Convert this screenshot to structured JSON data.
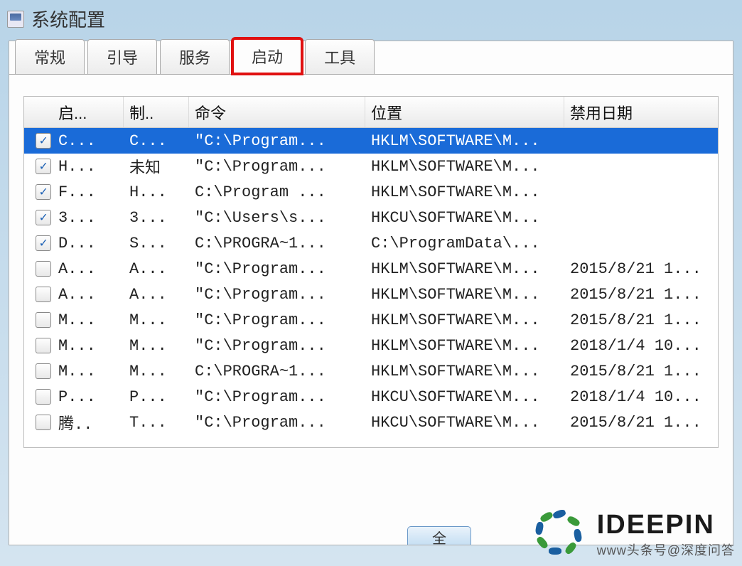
{
  "window": {
    "title": "系统配置"
  },
  "tabs": [
    {
      "label": "常规"
    },
    {
      "label": "引导"
    },
    {
      "label": "服务"
    },
    {
      "label": "启动"
    },
    {
      "label": "工具"
    }
  ],
  "columns": {
    "startup": "启...",
    "maker": "制..",
    "command": "命令",
    "location": "位置",
    "disabled_date": "禁用日期"
  },
  "rows": [
    {
      "checked": true,
      "selected": true,
      "startup": "C...",
      "maker": "C...",
      "cmd": "\"C:\\Program...",
      "loc": "HKLM\\SOFTWARE\\M...",
      "date": ""
    },
    {
      "checked": true,
      "selected": false,
      "startup": "H...",
      "maker": "未知",
      "cmd": "\"C:\\Program...",
      "loc": "HKLM\\SOFTWARE\\M...",
      "date": ""
    },
    {
      "checked": true,
      "selected": false,
      "startup": "F...",
      "maker": "H...",
      "cmd": "C:\\Program ...",
      "loc": "HKLM\\SOFTWARE\\M...",
      "date": ""
    },
    {
      "checked": true,
      "selected": false,
      "startup": "3...",
      "maker": "3...",
      "cmd": "\"C:\\Users\\s...",
      "loc": "HKCU\\SOFTWARE\\M...",
      "date": ""
    },
    {
      "checked": true,
      "selected": false,
      "startup": "D...",
      "maker": "S...",
      "cmd": "C:\\PROGRA~1...",
      "loc": "C:\\ProgramData\\...",
      "date": ""
    },
    {
      "checked": false,
      "selected": false,
      "startup": "A...",
      "maker": "A...",
      "cmd": "\"C:\\Program...",
      "loc": "HKLM\\SOFTWARE\\M...",
      "date": "2015/8/21 1..."
    },
    {
      "checked": false,
      "selected": false,
      "startup": "A...",
      "maker": "A...",
      "cmd": "\"C:\\Program...",
      "loc": "HKLM\\SOFTWARE\\M...",
      "date": "2015/8/21 1..."
    },
    {
      "checked": false,
      "selected": false,
      "startup": "M...",
      "maker": "M...",
      "cmd": "\"C:\\Program...",
      "loc": "HKLM\\SOFTWARE\\M...",
      "date": "2015/8/21 1..."
    },
    {
      "checked": false,
      "selected": false,
      "startup": "M...",
      "maker": "M...",
      "cmd": "\"C:\\Program...",
      "loc": "HKLM\\SOFTWARE\\M...",
      "date": "2018/1/4 10..."
    },
    {
      "checked": false,
      "selected": false,
      "startup": "M...",
      "maker": "M...",
      "cmd": "C:\\PROGRA~1...",
      "loc": "HKLM\\SOFTWARE\\M...",
      "date": "2015/8/21 1..."
    },
    {
      "checked": false,
      "selected": false,
      "startup": "P...",
      "maker": "P...",
      "cmd": "\"C:\\Program...",
      "loc": "HKCU\\SOFTWARE\\M...",
      "date": "2018/1/4 10..."
    },
    {
      "checked": false,
      "selected": false,
      "startup": "腾..",
      "maker": "T...",
      "cmd": "\"C:\\Program...",
      "loc": "HKCU\\SOFTWARE\\M...",
      "date": "2015/8/21 1..."
    }
  ],
  "button": {
    "label": "全"
  },
  "watermark": {
    "brand": "IDEEPIN",
    "subtitle": "www头条号@深度问答"
  }
}
